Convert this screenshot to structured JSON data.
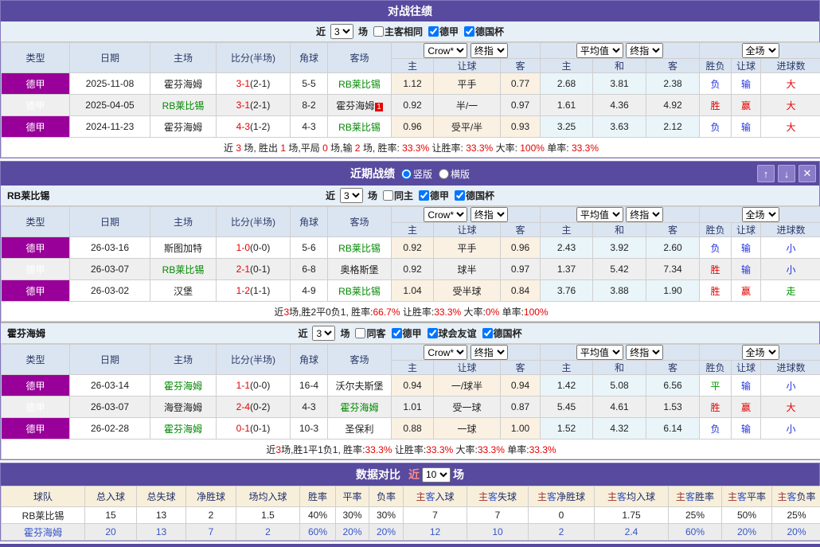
{
  "h2h": {
    "title": "对战往绩",
    "controls": {
      "near": "近",
      "count": "3",
      "unit": "场",
      "checks": [
        {
          "label": "主客相同",
          "checked": false
        },
        {
          "label": "德甲",
          "checked": true
        },
        {
          "label": "德国杯",
          "checked": true
        }
      ]
    },
    "cols": [
      "类型",
      "日期",
      "主场",
      "比分(半场)",
      "角球",
      "客场"
    ],
    "selects": {
      "odds1": "Crow*",
      "odds2": "终指",
      "avg1": "平均值",
      "avg2": "终指",
      "full": "全场"
    },
    "sub": [
      "主",
      "让球",
      "客",
      "主",
      "和",
      "客",
      "胜负",
      "让球",
      "进球数"
    ],
    "rows": [
      {
        "league": "德甲",
        "date": "2025-11-08",
        "home": "霍芬海姆",
        "home_c": "",
        "score": "3-1",
        "half": "(2-1)",
        "corner": "5-5",
        "away": "RB莱比锡",
        "away_c": "tg",
        "badge": "",
        "o1": "1.12",
        "line": "平手",
        "o2": "0.77",
        "a1": "2.68",
        "a2": "3.81",
        "a3": "2.38",
        "r1": "负",
        "r1c": "blue",
        "r2": "输",
        "r2c": "blue",
        "r3": "大",
        "r3c": "red"
      },
      {
        "league": "德甲",
        "date": "2025-04-05",
        "home": "RB莱比锡",
        "home_c": "tg",
        "score": "3-1",
        "half": "(2-1)",
        "corner": "8-2",
        "away": "霍芬海姆",
        "away_c": "",
        "badge": "1",
        "o1": "0.92",
        "line": "半/一",
        "o2": "0.97",
        "a1": "1.61",
        "a2": "4.36",
        "a3": "4.92",
        "r1": "胜",
        "r1c": "red",
        "r2": "赢",
        "r2c": "red",
        "r3": "大",
        "r3c": "red"
      },
      {
        "league": "德甲",
        "date": "2024-11-23",
        "home": "霍芬海姆",
        "home_c": "",
        "score": "4-3",
        "half": "(1-2)",
        "corner": "4-3",
        "away": "RB莱比锡",
        "away_c": "tg",
        "badge": "",
        "o1": "0.96",
        "line": "受平/半",
        "o2": "0.93",
        "a1": "3.25",
        "a2": "3.63",
        "a3": "2.12",
        "r1": "负",
        "r1c": "blue",
        "r2": "输",
        "r2c": "blue",
        "r3": "大",
        "r3c": "red"
      }
    ],
    "summary": [
      "近 ",
      "3",
      " 场, 胜出 ",
      "1",
      " 场,平局 ",
      "0",
      " 场,输 ",
      "2",
      " 场, 胜率: ",
      "33.3%",
      " 让胜率: ",
      "33.3%",
      " 大率: ",
      "100%",
      " 单率: ",
      "33.3%"
    ]
  },
  "recent": {
    "title": "近期战绩",
    "radios": [
      {
        "label": "竖版",
        "checked": true
      },
      {
        "label": "横版",
        "checked": false
      }
    ],
    "buttons": {
      "up": "↑",
      "down": "↓",
      "close": "✕"
    },
    "team1": {
      "name": "RB莱比锡",
      "controls": {
        "near": "近",
        "count": "3",
        "unit": "场",
        "checks": [
          {
            "label": "同主",
            "checked": false
          },
          {
            "label": "德甲",
            "checked": true
          },
          {
            "label": "德国杯",
            "checked": true
          }
        ]
      },
      "cols": [
        "类型",
        "日期",
        "主场",
        "比分(半场)",
        "角球",
        "客场"
      ],
      "selects": {
        "odds1": "Crow*",
        "odds2": "终指",
        "avg1": "平均值",
        "avg2": "终指",
        "full": "全场"
      },
      "sub": [
        "主",
        "让球",
        "客",
        "主",
        "和",
        "客",
        "胜负",
        "让球",
        "进球数"
      ],
      "rows": [
        {
          "league": "德甲",
          "date": "26-03-16",
          "home": "斯图加特",
          "home_c": "",
          "score": "1-0",
          "half": "(0-0)",
          "corner": "5-6",
          "away": "RB莱比锡",
          "away_c": "tg",
          "badge": "",
          "o1": "0.92",
          "line": "平手",
          "o2": "0.96",
          "a1": "2.43",
          "a2": "3.92",
          "a3": "2.60",
          "r1": "负",
          "r1c": "blue",
          "r2": "输",
          "r2c": "blue",
          "r3": "小",
          "r3c": "blue"
        },
        {
          "league": "德甲",
          "date": "26-03-07",
          "home": "RB莱比锡",
          "home_c": "tg",
          "score": "2-1",
          "half": "(0-1)",
          "corner": "6-8",
          "away": "奥格斯堡",
          "away_c": "",
          "badge": "",
          "o1": "0.92",
          "line": "球半",
          "o2": "0.97",
          "a1": "1.37",
          "a2": "5.42",
          "a3": "7.34",
          "r1": "胜",
          "r1c": "red",
          "r2": "输",
          "r2c": "blue",
          "r3": "小",
          "r3c": "blue"
        },
        {
          "league": "德甲",
          "date": "26-03-02",
          "home": "汉堡",
          "home_c": "",
          "score": "1-2",
          "half": "(1-1)",
          "corner": "4-9",
          "away": "RB莱比锡",
          "away_c": "tg",
          "badge": "",
          "o1": "1.04",
          "line": "受半球",
          "o2": "0.84",
          "a1": "3.76",
          "a2": "3.88",
          "a3": "1.90",
          "r1": "胜",
          "r1c": "red",
          "r2": "赢",
          "r2c": "red",
          "r3": "走",
          "r3c": "green"
        }
      ],
      "summary": [
        "近",
        "3",
        "场,胜2平0负1, 胜率:",
        "66.7%",
        " 让胜率:",
        "33.3%",
        " 大率:",
        "0%",
        " 单率:",
        "100%"
      ]
    },
    "team2": {
      "name": "霍芬海姆",
      "controls": {
        "near": "近",
        "count": "3",
        "unit": "场",
        "checks": [
          {
            "label": "同客",
            "checked": false
          },
          {
            "label": "德甲",
            "checked": true
          },
          {
            "label": "球会友谊",
            "checked": true
          },
          {
            "label": "德国杯",
            "checked": true
          }
        ]
      },
      "cols": [
        "类型",
        "日期",
        "主场",
        "比分(半场)",
        "角球",
        "客场"
      ],
      "selects": {
        "odds1": "Crow*",
        "odds2": "终指",
        "avg1": "平均值",
        "avg2": "终指",
        "full": "全场"
      },
      "sub": [
        "主",
        "让球",
        "客",
        "主",
        "和",
        "客",
        "胜负",
        "让球",
        "进球数"
      ],
      "rows": [
        {
          "league": "德甲",
          "date": "26-03-14",
          "home": "霍芬海姆",
          "home_c": "tg",
          "score": "1-1",
          "half": "(0-0)",
          "corner": "16-4",
          "away": "沃尔夫斯堡",
          "away_c": "",
          "badge": "",
          "o1": "0.94",
          "line": "一/球半",
          "o2": "0.94",
          "a1": "1.42",
          "a2": "5.08",
          "a3": "6.56",
          "r1": "平",
          "r1c": "green",
          "r2": "输",
          "r2c": "blue",
          "r3": "小",
          "r3c": "blue"
        },
        {
          "league": "德甲",
          "date": "26-03-07",
          "home": "海登海姆",
          "home_c": "",
          "score": "2-4",
          "half": "(0-2)",
          "corner": "4-3",
          "away": "霍芬海姆",
          "away_c": "tg",
          "badge": "",
          "o1": "1.01",
          "line": "受一球",
          "o2": "0.87",
          "a1": "5.45",
          "a2": "4.61",
          "a3": "1.53",
          "r1": "胜",
          "r1c": "red",
          "r2": "赢",
          "r2c": "red",
          "r3": "大",
          "r3c": "red"
        },
        {
          "league": "德甲",
          "date": "26-02-28",
          "home": "霍芬海姆",
          "home_c": "tg",
          "score": "0-1",
          "half": "(0-1)",
          "corner": "10-3",
          "away": "圣保利",
          "away_c": "",
          "badge": "",
          "o1": "0.88",
          "line": "一球",
          "o2": "1.00",
          "a1": "1.52",
          "a2": "4.32",
          "a3": "6.14",
          "r1": "负",
          "r1c": "blue",
          "r2": "输",
          "r2c": "blue",
          "r3": "小",
          "r3c": "blue"
        }
      ],
      "summary": [
        "近",
        "3",
        "场,胜1平1负1, 胜率:",
        "33.3%",
        " 让胜率:",
        "33.3%",
        " 大率:",
        "33.3%",
        " 单率:",
        "33.3%"
      ]
    }
  },
  "compare": {
    "title": "数据对比",
    "near": "近",
    "count": "10",
    "unit": "场",
    "headers_plain": [
      "球队",
      "总入球",
      "总失球",
      "净胜球",
      "场均入球",
      "胜率",
      "平率",
      "负率"
    ],
    "headers_split": [
      {
        "zhu": "主",
        "ke": "客",
        "rest": "入球"
      },
      {
        "zhu": "主",
        "ke": "客",
        "rest": "失球"
      },
      {
        "zhu": "主",
        "ke": "客",
        "rest": "净胜球"
      },
      {
        "zhu": "主",
        "ke": "客",
        "rest": "均入球"
      },
      {
        "zhu": "主",
        "ke": "客",
        "rest": "胜率"
      },
      {
        "zhu": "主",
        "ke": "客",
        "rest": "平率"
      },
      {
        "zhu": "主",
        "ke": "客",
        "rest": "负率"
      }
    ],
    "rows": [
      {
        "team": "RB莱比锡",
        "vals": [
          "15",
          "13",
          "2",
          "1.5",
          "40%",
          "30%",
          "30%",
          "7",
          "7",
          "0",
          "1.75",
          "25%",
          "50%",
          "25%"
        ]
      },
      {
        "team": "霍芬海姆",
        "vals": [
          "20",
          "13",
          "7",
          "2",
          "60%",
          "20%",
          "20%",
          "12",
          "10",
          "2",
          "2.4",
          "60%",
          "20%",
          "20%"
        ]
      }
    ]
  }
}
